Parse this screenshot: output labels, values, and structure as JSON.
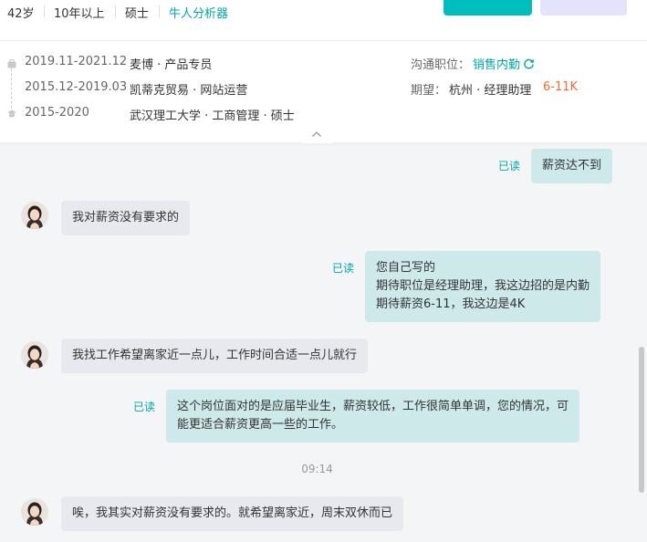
{
  "profile": {
    "age": "42岁",
    "experience": "10年以上",
    "education": "硕士",
    "tag": "牛人分析器"
  },
  "details": {
    "work": [
      {
        "period": "2019.11-2021.12",
        "company_role": "麦博 · 产品专员"
      },
      {
        "period": "2015.12-2019.03",
        "company_role": "凯蒂克贸易 · 网站运营"
      }
    ],
    "education": {
      "period": "2015-2020",
      "school": "武汉理工大学 · 工商管理 · 硕士"
    },
    "contact_label": "沟通职位：",
    "contact_value": "销售内勤",
    "expect_label": "期望：",
    "expect_value": "杭州 · 经理助理",
    "expect_salary": "6-11K"
  },
  "chat": {
    "messages": [
      {
        "from": "me",
        "text": "薪资达不到",
        "status": "已读"
      },
      {
        "from": "them",
        "text": "我对薪资没有要求的"
      },
      {
        "from": "me",
        "lines": [
          "您自己写的",
          "期待职位是经理助理，我这边招的是内勤",
          "期待薪资6-11，我这边是4K"
        ],
        "status": "已读"
      },
      {
        "from": "them",
        "text": "我找工作希望离家近一点儿，工作时间合适一点儿就行"
      },
      {
        "from": "me",
        "lines": [
          "这个岗位面对的是应届毕业生，薪资较低，工作很简单单调，您的情况，可",
          "能更适合薪资更高一些的工作。"
        ],
        "status": "已读"
      },
      {
        "from": "them",
        "text": "唉，我其实对薪资没有要求的。就希望离家近，周末双休而已"
      }
    ],
    "timestamp": "09:14"
  },
  "colors": {
    "accent": "#00a6a7",
    "salary": "#ff6633",
    "bubble_out": "#cde9ea",
    "bubble_in": "#e8e9ee"
  }
}
